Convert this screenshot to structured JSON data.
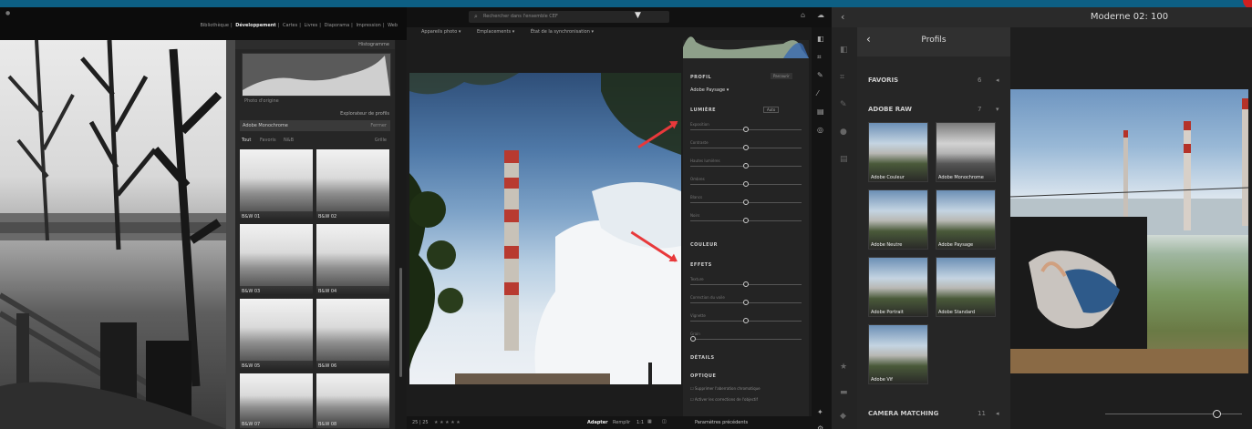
{
  "panel_lrc": {
    "module_nav": [
      "Bibliothèque",
      "Développement",
      "Cartes",
      "Livres",
      "Diaporama",
      "Impression",
      "Web"
    ],
    "histogram_label": "Histogramme",
    "histogram_note": "Photo d'origine",
    "profile_browser_title": "Explorateur de profils",
    "profile_name": "Adobe Monochrome",
    "close_label": "Fermer",
    "filter_tabs": [
      "Tout",
      "Favoris",
      "N&B"
    ],
    "grid_label": "Grille",
    "thumbnails": [
      "B&W 01",
      "B&W 02",
      "B&W 03",
      "B&W 04",
      "B&W 05",
      "B&W 06",
      "B&W 07",
      "B&W 08"
    ]
  },
  "panel_lrcc": {
    "search_placeholder": "Rechercher dans l'ensemble CEF",
    "filters": [
      "Appareils photo ▾",
      "Emplacements ▾",
      "État de la synchronisation ▾"
    ],
    "profile_section": "PROFIL",
    "profile_browse": "Parcourir",
    "profile_value": "Adobe Paysage ▾",
    "light_section": "LUMIÈRE",
    "auto_label": "Auto",
    "light_sliders": [
      {
        "name": "Exposition",
        "value": 0.5
      },
      {
        "name": "Contraste",
        "value": 0.5
      },
      {
        "name": "Hautes lumières",
        "value": 0.5
      },
      {
        "name": "Ombres",
        "value": 0.5
      },
      {
        "name": "Blancs",
        "value": 0.5
      },
      {
        "name": "Noirs",
        "value": 0.5
      }
    ],
    "color_section": "COULEUR",
    "effects_section": "EFFETS",
    "effects_sliders": [
      {
        "name": "Texture",
        "value": 0.5
      },
      {
        "name": "Correction du voile",
        "value": 0.5
      },
      {
        "name": "Vignette",
        "value": 0.5
      },
      {
        "name": "Grain",
        "value": 0.0
      }
    ],
    "details_section": "DÉTAILS",
    "optics_section": "OPTIQUE",
    "optics_options": [
      "Supprimer l'aberration chromatique",
      "Activer les corrections de l'objectif"
    ],
    "bottom_left": "25 | 25",
    "rating_stars": "★ ★ ★ ★ ★",
    "fit_label": "Adapter",
    "fill_label": "Remplir",
    "ratio_label": "1:1",
    "previous_params": "Paramètres précédents",
    "accent_arrow": "#e8393b"
  },
  "panel_ipad": {
    "title": "Moderne 02: 100",
    "profiles_title": "Profils",
    "favorites": {
      "label": "FAVORIS",
      "count": "6"
    },
    "adobe_raw": {
      "label": "ADOBE RAW",
      "count": "7"
    },
    "raw_profiles": [
      "Adobe Couleur",
      "Adobe Monochrome",
      "Adobe Neutre",
      "Adobe Paysage",
      "Adobe Portrait",
      "Adobe Standard",
      "Adobe Vif"
    ],
    "camera_matching": {
      "label": "CAMERA MATCHING",
      "count": "11"
    },
    "slider_value": 0.8
  }
}
